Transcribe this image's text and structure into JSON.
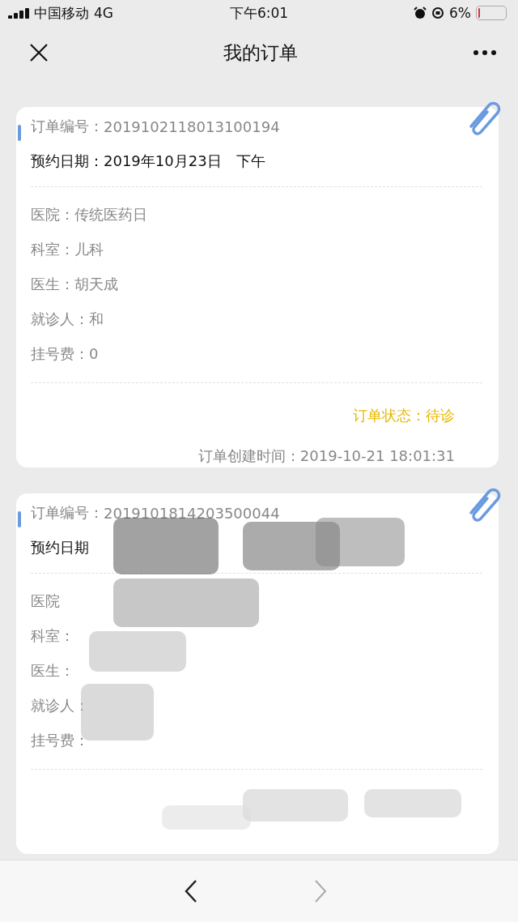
{
  "status_bar": {
    "carrier": "中国移动",
    "network": "4G",
    "time": "下午6:01",
    "battery": "6%"
  },
  "nav": {
    "title": "我的订单"
  },
  "orders": [
    {
      "order_no_label": "订单编号：",
      "order_no": "2019102118013100194",
      "appointment_label": "预约日期：",
      "appointment": "2019年10月23日　下午",
      "fields": [
        {
          "label": "医院：",
          "value": "传统医药日"
        },
        {
          "label": "科室：",
          "value": "儿科"
        },
        {
          "label": "医生：",
          "value": "胡天成"
        },
        {
          "label": "就诊人：",
          "value": "和"
        },
        {
          "label": "挂号费：",
          "value": "0"
        }
      ],
      "status_label": "订单状态：",
      "status": "待诊",
      "created_label": "订单创建时间：",
      "created": "2019-10-21 18:01:31",
      "redacted": false
    },
    {
      "order_no_label": "订单编号：",
      "order_no": "2019101814203500044",
      "appointment_label": "预约日期",
      "fields": [
        {
          "label": "医院"
        },
        {
          "label": "科室："
        },
        {
          "label": "医生："
        },
        {
          "label": "就诊人："
        },
        {
          "label": "挂号费："
        }
      ],
      "redacted": true
    }
  ],
  "toolbar": {
    "back_disabled": false,
    "forward_disabled": true
  }
}
